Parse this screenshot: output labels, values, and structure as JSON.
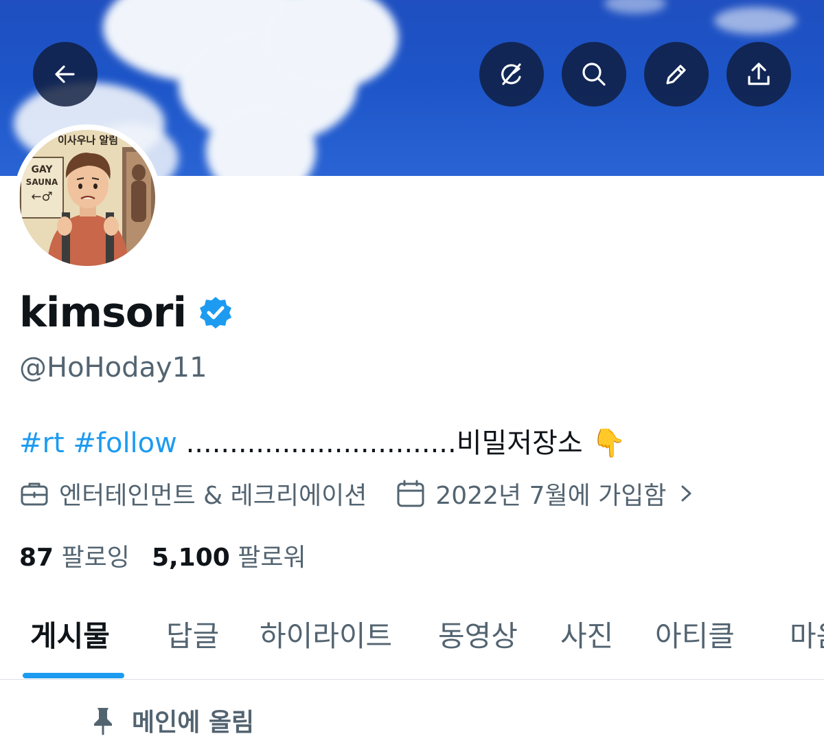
{
  "profile": {
    "display_name": "kimsori",
    "handle": "@HoHoday11",
    "bio": {
      "hashtag_rt": "#rt",
      "hashtag_follow": "#follow",
      "text": " ...............................비밀저장소 ",
      "emoji": "👇"
    },
    "category": "엔터테인먼트 & 레크리에이션",
    "joined": "2022년 7월에 가입함",
    "following_count": "87",
    "following_label": "팔로잉",
    "followers_count": "5,100",
    "followers_label": "팔로워"
  },
  "avatar": {
    "sign_top": "이사우나 알림",
    "sign_line1": "GAY",
    "sign_line2": "SAUNA",
    "sign_line3": "←♂"
  },
  "header_buttons": {
    "back": "back-arrow-icon",
    "grok": "grok-icon",
    "search": "search-icon",
    "edit": "pencil-icon",
    "share": "share-icon"
  },
  "tabs": [
    "게시물",
    "답글",
    "하이라이트",
    "동영상",
    "사진",
    "아티클",
    "마음"
  ],
  "pinned_label": "메인에 올림",
  "colors": {
    "accent": "#1d9bf0",
    "verified": "#1d9bf0",
    "text_primary": "#0f1419",
    "text_secondary": "#536471"
  }
}
